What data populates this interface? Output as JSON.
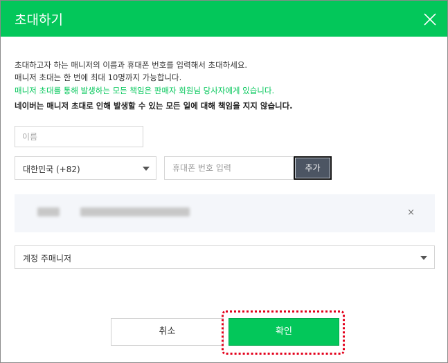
{
  "dialog": {
    "title": "초대하기",
    "close_icon": "close-icon"
  },
  "description": {
    "line1": "초대하고자 하는 매니저의 이름과 휴대폰 번호를 입력해서 초대하세요.",
    "line2": "매니저 초대는 한 번에 최대 10명까지 가능합니다.",
    "notice_green": "매니저 초대를 통해 발생하는 모든 책임은 판매자 회원님 당사자에게 있습니다.",
    "notice_bold": "네이버는 매니저 초대로 인해 발생할 수 있는 모든 일에 대해 책임을 지지 않습니다."
  },
  "form": {
    "name_placeholder": "이름",
    "country_value": "대한민국 (+82)",
    "phone_placeholder": "휴대폰 번호 입력",
    "add_label": "추가"
  },
  "entry": {
    "remove_label": "×"
  },
  "role_select": {
    "value": "계정 주매니저"
  },
  "buttons": {
    "cancel": "취소",
    "confirm": "확인"
  },
  "colors": {
    "brand_green": "#03c75a",
    "highlight_red": "#e3001b",
    "add_button": "#4c5563"
  }
}
